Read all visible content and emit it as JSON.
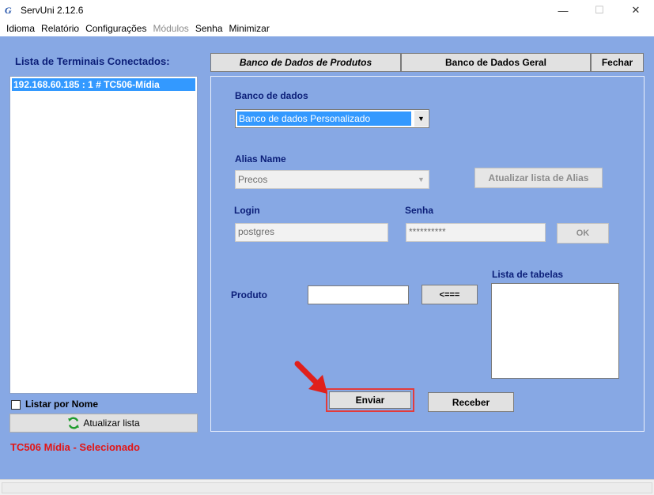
{
  "window": {
    "title": "ServUni 2.12.6",
    "app_icon": "G",
    "controls": {
      "minimize": "—",
      "maximize": "☐",
      "close": "✕"
    }
  },
  "menu": [
    {
      "label": "Idioma",
      "enabled": true
    },
    {
      "label": "Relatório",
      "enabled": true
    },
    {
      "label": "Configurações",
      "enabled": true
    },
    {
      "label": "Módulos",
      "enabled": false
    },
    {
      "label": "Senha",
      "enabled": true
    },
    {
      "label": "Minimizar",
      "enabled": true
    }
  ],
  "sidebar": {
    "title": "Lista de Terminais Conectados:",
    "terminals": [
      "192.168.60.185 : 1 # TC506-Mídia"
    ],
    "listar_por_nome_label": "Listar por Nome",
    "listar_por_nome_checked": false,
    "atualizar_label": "Atualizar lista",
    "status": "TC506 Mídia - Selecionado"
  },
  "tabs": {
    "produtos": "Banco de Dados de Produtos",
    "geral": "Banco de Dados Geral",
    "fechar": "Fechar"
  },
  "form": {
    "banco_label": "Banco de dados",
    "banco_value": "Banco de dados Personalizado",
    "alias_label": "Alias Name",
    "alias_value": "Precos",
    "atualizar_alias_label": "Atualizar lista de Alias",
    "login_label": "Login",
    "login_value": "postgres",
    "senha_label": "Senha",
    "senha_value": "**********",
    "ok_label": "OK",
    "produto_label": "Produto",
    "produto_value": "",
    "arrow_label": "<===",
    "tabelas_label": "Lista de tabelas",
    "enviar_label": "Enviar",
    "receber_label": "Receber"
  },
  "colors": {
    "background": "#87a8e4",
    "label_text": "#0b1e78",
    "selection": "#3399ff",
    "status_text": "#e21717",
    "highlight": "#e33b3b"
  }
}
